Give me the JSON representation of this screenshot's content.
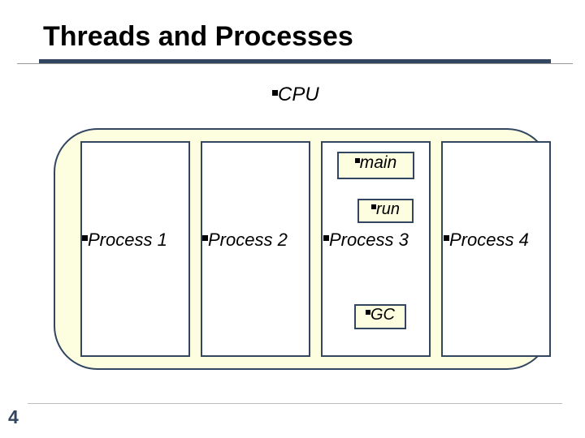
{
  "title": "Threads and Processes",
  "cpu_label": "CPU",
  "processes": {
    "p1": "Process 1",
    "p2": "Process 2",
    "p3": "Process 3",
    "p4": "Process 4"
  },
  "threads": {
    "main": "main",
    "run": "run",
    "gc": "GC"
  },
  "page_number": "4"
}
